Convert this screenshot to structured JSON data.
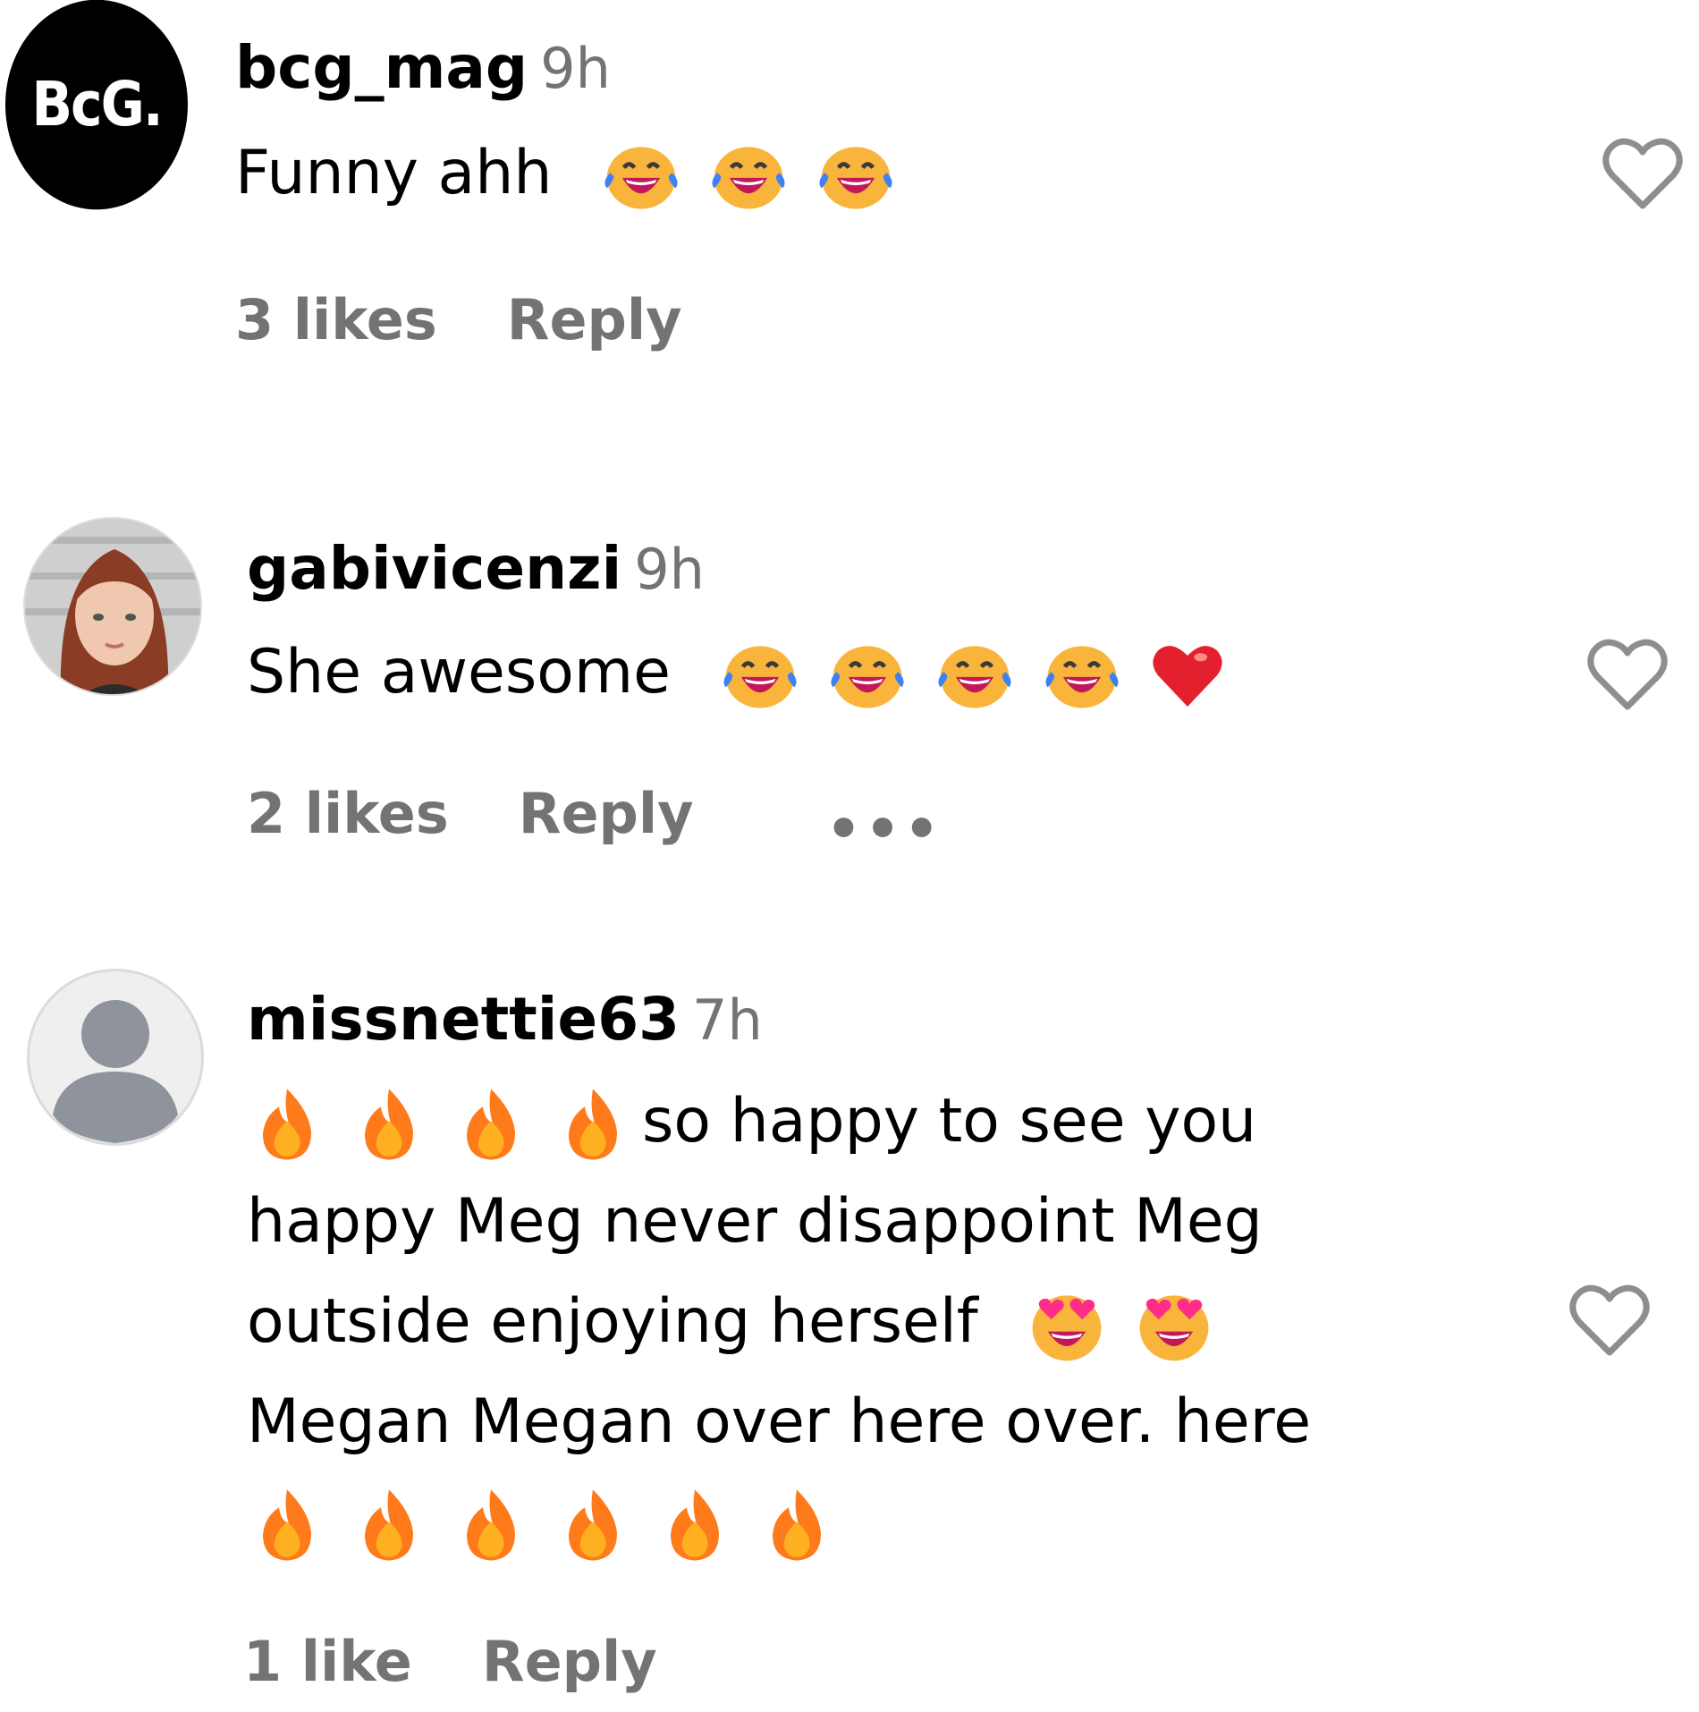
{
  "comments": [
    {
      "avatar_text": "BcG.",
      "username": "bcg_mag",
      "time": "9h",
      "text_lines": [
        "Funny ahh"
      ],
      "emojis": [
        "tears-of-joy-emoji",
        "tears-of-joy-emoji",
        "tears-of-joy-emoji"
      ],
      "likes": "3 likes",
      "reply": "Reply"
    },
    {
      "username": "gabivicenzi",
      "time": "9h",
      "text_lines": [
        "She awesome"
      ],
      "emojis": [
        "tears-of-joy-emoji",
        "tears-of-joy-emoji",
        "tears-of-joy-emoji",
        "tears-of-joy-emoji",
        "red-heart-emoji"
      ],
      "likes": "2 likes",
      "reply": "Reply",
      "more": "•••"
    },
    {
      "username": "missnettie63",
      "time": "7h",
      "text_lines": [
        "so happy to see you",
        "happy Meg never disappoint Meg",
        "outside enjoying herself",
        "Megan Megan over here over. here"
      ],
      "emojis_line1": [
        "fire-emoji",
        "fire-emoji",
        "fire-emoji",
        "fire-emoji"
      ],
      "emojis_line3": [
        "heart-eyes-emoji",
        "heart-eyes-emoji"
      ],
      "emojis_line5": [
        "fire-emoji",
        "fire-emoji",
        "fire-emoji",
        "fire-emoji",
        "fire-emoji",
        "fire-emoji"
      ],
      "likes": "1 like",
      "reply": "Reply"
    }
  ],
  "colors": {
    "username": "#000000",
    "secondary": "#737373",
    "heart_outline": "#8e8e8e",
    "emoji_face": "#f9b43b",
    "emoji_mouth": "#c2185b",
    "emoji_tear": "#3b82f6",
    "fire": "#ff8c1a",
    "red_heart": "#e5202e",
    "pink_eyes": "#ff2d8a"
  }
}
